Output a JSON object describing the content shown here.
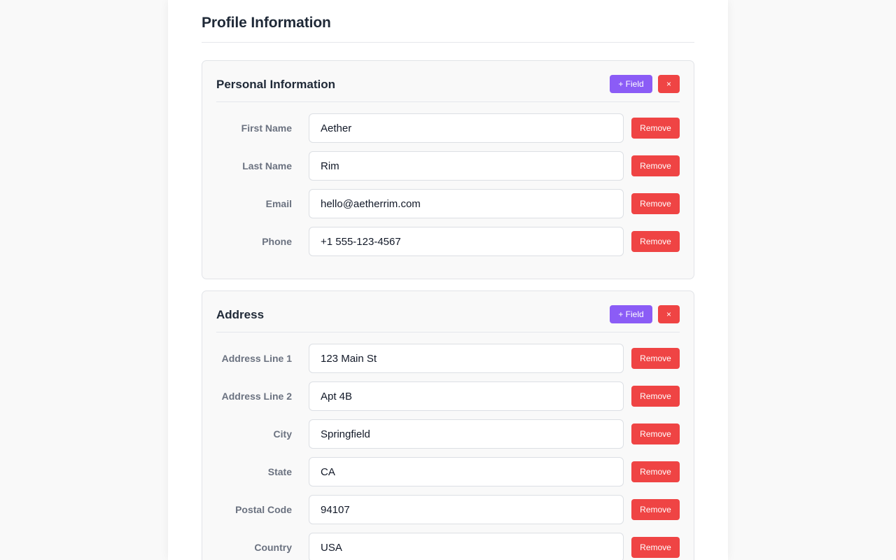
{
  "page": {
    "title": "Profile Information"
  },
  "sections": [
    {
      "title": "Personal Information",
      "add_field_label": "+ Field",
      "close_label": "×",
      "fields": [
        {
          "label": "First Name",
          "value": "Aether",
          "remove_label": "Remove"
        },
        {
          "label": "Last Name",
          "value": "Rim",
          "remove_label": "Remove"
        },
        {
          "label": "Email",
          "value": "hello@aetherrim.com",
          "remove_label": "Remove"
        },
        {
          "label": "Phone",
          "value": "+1 555-123-4567",
          "remove_label": "Remove"
        }
      ]
    },
    {
      "title": "Address",
      "add_field_label": "+ Field",
      "close_label": "×",
      "fields": [
        {
          "label": "Address Line 1",
          "value": "123 Main St",
          "remove_label": "Remove"
        },
        {
          "label": "Address Line 2",
          "value": "Apt 4B",
          "remove_label": "Remove"
        },
        {
          "label": "City",
          "value": "Springfield",
          "remove_label": "Remove"
        },
        {
          "label": "State",
          "value": "CA",
          "remove_label": "Remove"
        },
        {
          "label": "Postal Code",
          "value": "94107",
          "remove_label": "Remove"
        },
        {
          "label": "Country",
          "value": "USA",
          "remove_label": "Remove"
        }
      ]
    }
  ],
  "colors": {
    "accent_purple": "#8b5cf6",
    "danger_red": "#ef4444"
  }
}
